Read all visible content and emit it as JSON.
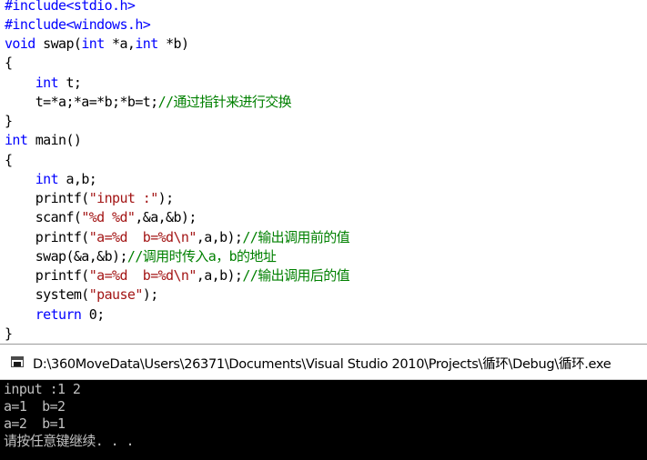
{
  "editor": {
    "lines": [
      [
        {
          "t": "#include<stdio.h>",
          "c": "kw"
        }
      ],
      [
        {
          "t": "#include<windows.h>",
          "c": "kw"
        }
      ],
      [
        {
          "t": "void",
          "c": "kw"
        },
        {
          "t": " swap(",
          "c": ""
        },
        {
          "t": "int",
          "c": "kw"
        },
        {
          "t": " *a,",
          "c": ""
        },
        {
          "t": "int",
          "c": "kw"
        },
        {
          "t": " *b)",
          "c": ""
        }
      ],
      [
        {
          "t": "{",
          "c": ""
        }
      ],
      [
        {
          "t": "    ",
          "c": ""
        },
        {
          "t": "int",
          "c": "kw"
        },
        {
          "t": " t;",
          "c": ""
        }
      ],
      [
        {
          "t": "    t=*a;*a=*b;*b=t;",
          "c": ""
        },
        {
          "t": "//通过指针来进行交换",
          "c": "cmt"
        }
      ],
      [
        {
          "t": "}",
          "c": ""
        }
      ],
      [
        {
          "t": "int",
          "c": "kw"
        },
        {
          "t": " main()",
          "c": ""
        }
      ],
      [
        {
          "t": "{",
          "c": ""
        }
      ],
      [
        {
          "t": "    ",
          "c": ""
        },
        {
          "t": "int",
          "c": "kw"
        },
        {
          "t": " a,b;",
          "c": ""
        }
      ],
      [
        {
          "t": "    printf(",
          "c": ""
        },
        {
          "t": "\"input :\"",
          "c": "str"
        },
        {
          "t": ");",
          "c": ""
        }
      ],
      [
        {
          "t": "    scanf(",
          "c": ""
        },
        {
          "t": "\"%d %d\"",
          "c": "str"
        },
        {
          "t": ",&a,&b);",
          "c": ""
        }
      ],
      [
        {
          "t": "    printf(",
          "c": ""
        },
        {
          "t": "\"a=%d  b=%d\\n\"",
          "c": "str"
        },
        {
          "t": ",a,b);",
          "c": ""
        },
        {
          "t": "//输出调用前的值",
          "c": "cmt"
        }
      ],
      [
        {
          "t": "    swap(&a,&b);",
          "c": ""
        },
        {
          "t": "//调用时传入a，b的地址",
          "c": "cmt"
        }
      ],
      [
        {
          "t": "    printf(",
          "c": ""
        },
        {
          "t": "\"a=%d  b=%d\\n\"",
          "c": "str"
        },
        {
          "t": ",a,b);",
          "c": ""
        },
        {
          "t": "//输出调用后的值",
          "c": "cmt"
        }
      ],
      [
        {
          "t": "    system(",
          "c": ""
        },
        {
          "t": "\"pause\"",
          "c": "str"
        },
        {
          "t": ");",
          "c": ""
        }
      ],
      [
        {
          "t": "    ",
          "c": ""
        },
        {
          "t": "return",
          "c": "kw"
        },
        {
          "t": " 0;",
          "c": ""
        }
      ],
      [
        {
          "t": "}",
          "c": ""
        }
      ]
    ]
  },
  "console": {
    "title": "D:\\360MoveData\\Users\\26371\\Documents\\Visual Studio 2010\\Projects\\循环\\Debug\\循环.exe",
    "icon": "console-window-icon",
    "output": [
      "input :1 2",
      "a=1  b=2",
      "a=2  b=1",
      "请按任意键继续. . ."
    ]
  }
}
